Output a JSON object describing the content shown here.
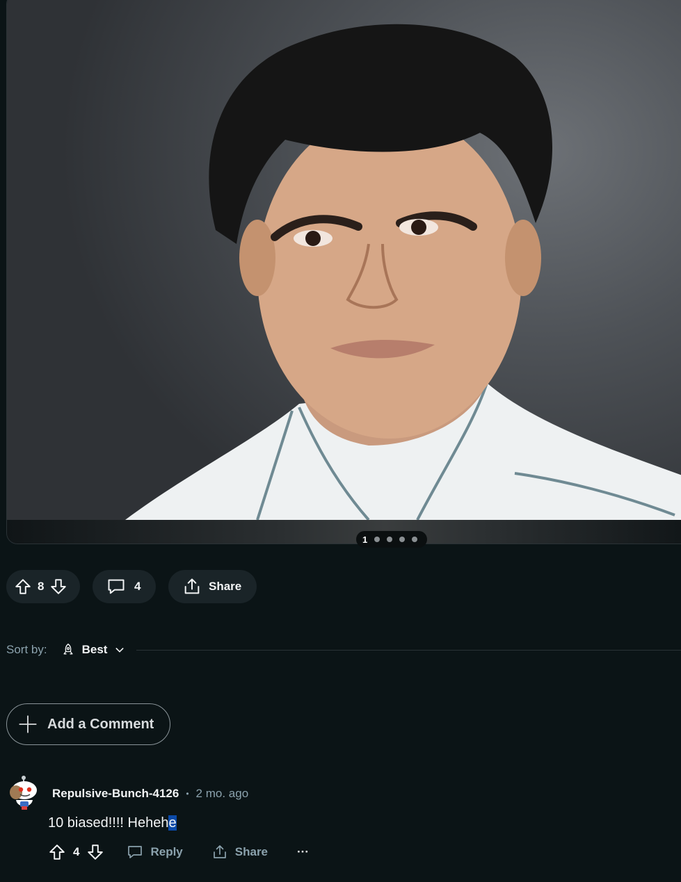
{
  "gallery": {
    "current_page": "1",
    "dot_count": 4
  },
  "post_actions": {
    "upvote_count": "8",
    "comment_count": "4",
    "share_label": "Share"
  },
  "sort": {
    "label": "Sort by:",
    "value": "Best"
  },
  "add_comment": {
    "label": "Add a Comment"
  },
  "comments": [
    {
      "author": "Repulsive-Bunch-4126",
      "separator": "•",
      "time": "2 mo. ago",
      "body": "10 biased!!!! Heheh",
      "body_selected": "e",
      "score": "4",
      "reply_label": "Reply",
      "share_label": "Share",
      "more_label": "···"
    }
  ],
  "colors": {
    "background": "#0b1416",
    "pill": "#1a2428",
    "muted": "#8ba2ad",
    "text": "#f2f4f5",
    "selection": "#0b4aa8"
  },
  "icons": [
    "upvote-icon",
    "downvote-icon",
    "comment-icon",
    "share-icon",
    "rocket-icon",
    "chevron-down-icon",
    "plus-icon",
    "reply-icon",
    "more-icon"
  ]
}
